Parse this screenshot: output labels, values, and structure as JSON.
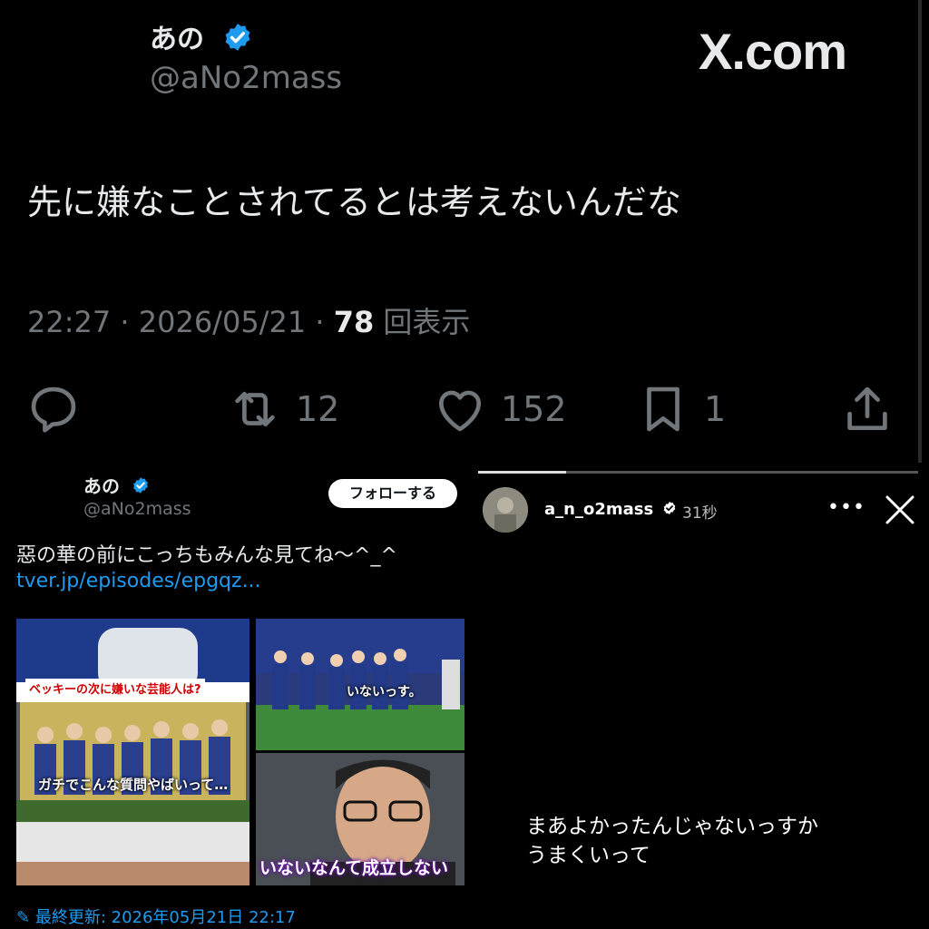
{
  "top_tweet": {
    "display_name": "あの",
    "handle": "@aNo2mass",
    "site_label": "X.com",
    "text": "先に嫌なことされてるとは考えないんだな",
    "time": "22:27 · 2026/05/21 · ",
    "views_count": "78",
    "views_label": " 回表示",
    "actions": {
      "reply_count": "",
      "retweet_count": "12",
      "like_count": "152",
      "bookmark_count": "1"
    }
  },
  "embed_tweet": {
    "display_name": "あの",
    "handle": "@aNo2mass",
    "follow_label": "フォローする",
    "text": "惡の華の前にこっちもみんな見てね〜^_^",
    "link": "tver.jp/episodes/epgqz...",
    "media_captions": {
      "banner": "ベッキーの次に嫌いな芸能人は?",
      "subtitle1": "ガチでこんな質問やばいって…",
      "subtitle2": "いないっす。",
      "subtitle3": "いないなんて成立しない"
    },
    "updated": "最終更新: 2026年05月21日 22:17"
  },
  "story": {
    "username": "a_n_o2mass",
    "time": "31秒",
    "progress_fraction": 0.2,
    "text_line1": "まあよかったんじゃないっすか",
    "text_line2": "うまくいって"
  },
  "colors": {
    "accent_blue": "#1d9bf0",
    "muted_gray": "#71767b",
    "text_primary": "#e7e9ea",
    "background": "#000000"
  }
}
